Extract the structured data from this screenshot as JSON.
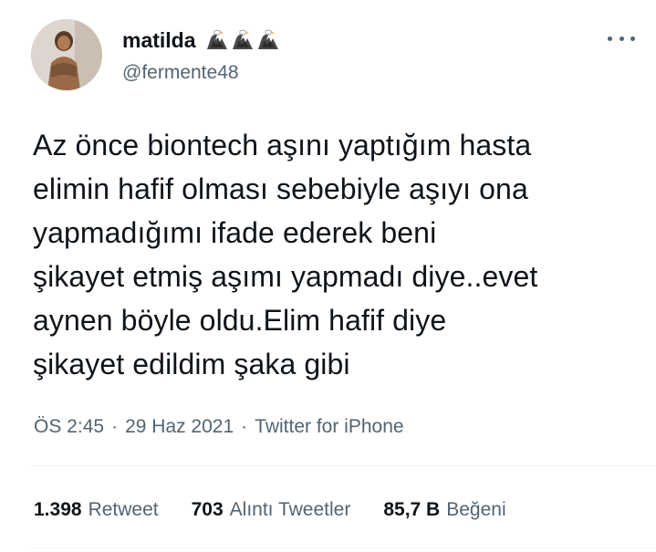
{
  "user": {
    "display_name": "matilda",
    "handle": "@fermente48",
    "badge_icons": [
      "eagle-emoji-icon",
      "eagle-emoji-icon",
      "eagle-emoji-icon"
    ]
  },
  "tweet": {
    "text": "Az önce biontech aşını yaptığım hasta\nelimin hafif olması sebebiyle aşıyı ona\nyapmadığımı ifade ederek beni\nşikayet etmiş aşımı yapmadı diye..evet\naynen böyle oldu.Elim hafif diye\nşikayet edildim şaka gibi",
    "time": "ÖS 2:45",
    "separator": "·",
    "date": "29 Haz 2021",
    "source": "Twitter for iPhone"
  },
  "stats": {
    "retweets_count": "1.398",
    "retweets_label": "Retweet",
    "quotes_count": "703",
    "quotes_label": "Alıntı Tweetler",
    "likes_count": "85,7 B",
    "likes_label": "Beğeni"
  },
  "colors": {
    "text_primary": "#0f1419",
    "text_secondary": "#536471",
    "divider": "#eff3f4",
    "background": "#ffffff"
  }
}
